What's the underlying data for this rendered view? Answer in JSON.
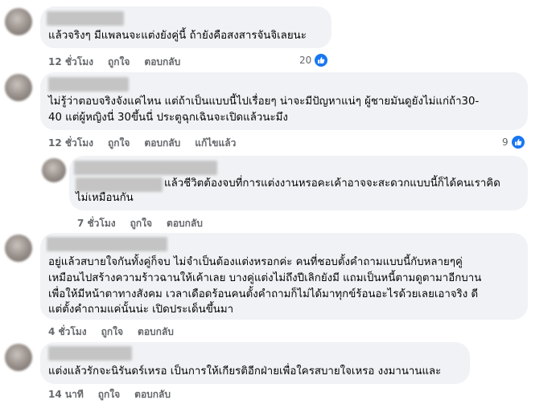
{
  "comments": [
    {
      "text_lines": [
        "แล้วจริงๆ มีแพลนจะแต่งยังคู่นี้ ถ้ายังคือสงสารจันจิเลยนะ"
      ],
      "time": "12 ชั่วโมง",
      "like_label": "ถูกใจ",
      "reply_label": "ตอบกลับ",
      "reaction_count": "20"
    },
    {
      "text_lines": [
        "ไม่รู้ว่าตอบจริงจังแค่ไหน แต่ถ้าเป็นแบบนี้ไปเรื่อยๆ น่าจะมีปัญหาแน่ๆ ผู้ชายมันดูยังไม่แก่ถ้า30-",
        "40 แต่ผู้หญิงนี่ 30ขึ้นนี่ ประตูฉุกเฉินจะเปิดแล้วนะมึง"
      ],
      "time": "12 ชั่วโมง",
      "like_label": "ถูกใจ",
      "reply_label": "ตอบกลับ",
      "edited_label": "แก้ไขแล้ว",
      "reaction_count": "9"
    },
    {
      "text_lines": [
        "แล้วชีวิตต้องจบที่การแต่งงานหรอคะเค้าอาจจะสะดวกแบบนี้ก็ได้คนเราคิด",
        "ไม่เหมือนกัน"
      ],
      "time": "7 ชั่วโมง",
      "like_label": "ถูกใจ",
      "reply_label": "ตอบกลับ"
    },
    {
      "text_lines": [
        "อยู่แล้วสบายใจกันทั้งคู่ก็จบ ไม่จำเป็นต้องแต่งหรอกค่ะ คนที่ชอบตั้งคำถามแบบนี้กับหลายๆคู่",
        "เหมือนไปสร้างความร้าวฉานให้เค้าเลย บางคู่แต่งไม่ถึงปีเลิกยังมี แถมเป็นหนี้ตามดูตามาอีกบาน",
        "เพื่อให้มีหน้าตาทางสังคม เวลาเดือดร้อนคนตั้งคำถามก็ไม่ได้มาทุกข์ร้อนอะไรด้วยเลยเอาจริง ดี",
        "แต่ตั้งคำถามแค่นั้นน่ะ เปิดประเด็นขึ้นมา"
      ],
      "time": "4 ชั่วโมง",
      "like_label": "ถูกใจ",
      "reply_label": "ตอบกลับ"
    },
    {
      "text_lines": [
        "แต่งแล้วรักจะนิรันดร์เหรอ เป็นการให้เกียรติอีกฝ่ายเพื่อใครสบายใจเหรอ งงมานานและ"
      ],
      "time": "14 นาที",
      "like_label": "ถูกใจ",
      "reply_label": "ตอบกลับ"
    }
  ],
  "colors": {
    "bubble": "#f0f2f5",
    "meta_text": "#65676b",
    "like_blue": "#1877f2"
  },
  "icons": [
    "like-icon"
  ]
}
